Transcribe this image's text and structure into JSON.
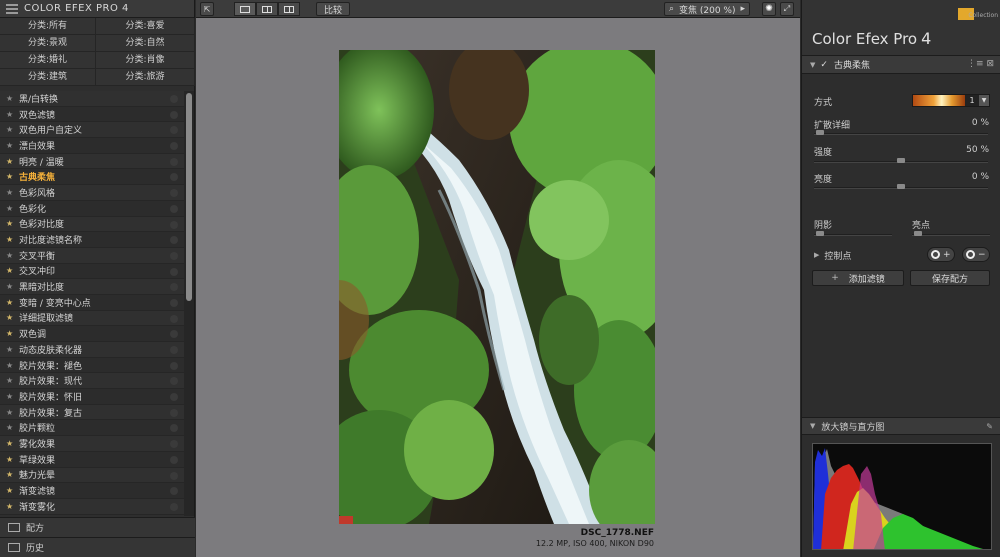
{
  "app": {
    "title": "COLOR EFEX PRO 4"
  },
  "categories": [
    {
      "label": "分类:所有"
    },
    {
      "label": "分类:喜爱"
    },
    {
      "label": "分类:景观"
    },
    {
      "label": "分类:自然"
    },
    {
      "label": "分类:婚礼"
    },
    {
      "label": "分类:肖像"
    },
    {
      "label": "分类:建筑"
    },
    {
      "label": "分类:旅游"
    }
  ],
  "filters": [
    {
      "name": "黑/白转换",
      "fav": false
    },
    {
      "name": "双色滤镜",
      "fav": false
    },
    {
      "name": "双色用户自定义",
      "fav": false
    },
    {
      "name": "漂白效果",
      "fav": false
    },
    {
      "name": "明亮 / 温暖",
      "fav": true
    },
    {
      "name": "古典柔焦",
      "fav": true,
      "active": true
    },
    {
      "name": "色彩风格",
      "fav": false
    },
    {
      "name": "色彩化",
      "fav": false
    },
    {
      "name": "色彩对比度",
      "fav": true
    },
    {
      "name": "对比度滤镜名称",
      "fav": true
    },
    {
      "name": "交叉平衡",
      "fav": false
    },
    {
      "name": "交叉冲印",
      "fav": true
    },
    {
      "name": "黑暗对比度",
      "fav": false
    },
    {
      "name": "变暗 / 变亮中心点",
      "fav": true
    },
    {
      "name": "详细提取滤镜",
      "fav": true
    },
    {
      "name": "双色调",
      "fav": true
    },
    {
      "name": "动态皮肤柔化器",
      "fav": false
    },
    {
      "name": "胶片效果：褪色",
      "fav": false
    },
    {
      "name": "胶片效果：现代",
      "fav": false
    },
    {
      "name": "胶片效果：怀旧",
      "fav": false
    },
    {
      "name": "胶片效果：复古",
      "fav": false
    },
    {
      "name": "胶片颗粒",
      "fav": false
    },
    {
      "name": "雾化效果",
      "fav": true
    },
    {
      "name": "草绿效果",
      "fav": true
    },
    {
      "name": "魅力光晕",
      "fav": true
    },
    {
      "name": "渐变滤镜",
      "fav": true
    },
    {
      "name": "渐变雾化",
      "fav": true
    }
  ],
  "bottom": {
    "recipes": "配方",
    "history": "历史"
  },
  "toolbar": {
    "compare": "比较",
    "zoom": "变焦 (200 %)",
    "zoom_arrow": "▸"
  },
  "image": {
    "filename": "DSC_1778.NEF",
    "meta": "12.2 MP, ISO 400, NIKON D90"
  },
  "right": {
    "brand": "Color Efex Pro",
    "brand_num": "4",
    "collection": "Collection",
    "filter_title": "古典柔焦",
    "method_label": "方式",
    "method_value": "1",
    "controls": {
      "spread_label": "扩散详细",
      "spread_value": "0 %",
      "strength_label": "强度",
      "strength_value": "50 %",
      "brightness_label": "亮度",
      "brightness_value": "0 %",
      "shadows_label": "阴影",
      "highlights_label": "亮点"
    },
    "control_points": "控制点",
    "add_filter": "添加滤镜",
    "save_recipe": "保存配方",
    "loupe": "放大镜与直方图"
  },
  "colors": {
    "accent": "#f4b03a",
    "canvas": "#7c7b7e",
    "panel": "#2d2d2d"
  }
}
